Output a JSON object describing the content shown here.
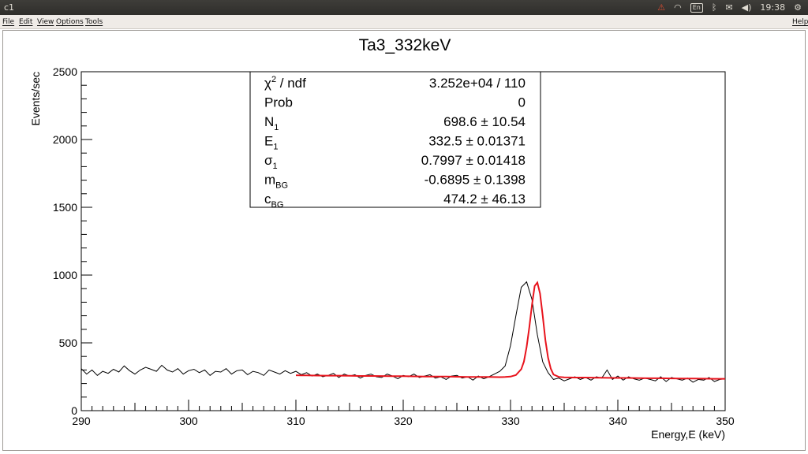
{
  "window": {
    "title": "c1"
  },
  "tray": {
    "network_alert_icon": "network-alert-icon",
    "keyboard_layout": "En",
    "clock": "19:38"
  },
  "menu": {
    "file": "File",
    "edit": "Edit",
    "view": "View",
    "options": "Options",
    "tools": "Tools",
    "help": "Help"
  },
  "colors": {
    "data": "#000000",
    "fit": "#e8141d",
    "frame": "#000000"
  },
  "stats": {
    "rows": [
      {
        "name": "χ",
        "sup": "2",
        "sub": "",
        "suffix": " / ndf",
        "value": "3.252e+04 / 110"
      },
      {
        "name": "Prob",
        "sup": "",
        "sub": "",
        "suffix": "",
        "value": "0"
      },
      {
        "name": "N",
        "sup": "",
        "sub": "1",
        "suffix": "",
        "value": "698.6 ± 10.54"
      },
      {
        "name": "E",
        "sup": "",
        "sub": "1",
        "suffix": "",
        "value": "332.5 ± 0.01371"
      },
      {
        "name": "σ",
        "sup": "",
        "sub": "1",
        "suffix": "",
        "value": "0.7997 ± 0.01418"
      },
      {
        "name": "m",
        "sup": "",
        "sub": "BG",
        "suffix": "",
        "value": "-0.6895 ± 0.1398"
      },
      {
        "name": "c",
        "sup": "",
        "sub": "BG",
        "suffix": "",
        "value": "474.2 ± 46.13"
      }
    ]
  },
  "chart_data": {
    "type": "line",
    "title": "Ta3_332keV",
    "xlabel": "Energy,E (keV)",
    "ylabel": "Events/sec",
    "xlim": [
      290,
      350
    ],
    "ylim": [
      0,
      2500
    ],
    "xticks": [
      290,
      300,
      310,
      320,
      330,
      340,
      350
    ],
    "yticks": [
      0,
      500,
      1000,
      1500,
      2000,
      2500
    ],
    "grid": false,
    "legend": "none",
    "series": [
      {
        "kind": "histogram",
        "x": [
          290.0,
          290.5,
          291.0,
          291.5,
          292.0,
          292.5,
          293.0,
          293.5,
          294.0,
          294.5,
          295.0,
          295.5,
          296.0,
          296.5,
          297.0,
          297.5,
          298.0,
          298.5,
          299.0,
          299.5,
          300.0,
          300.5,
          301.0,
          301.5,
          302.0,
          302.5,
          303.0,
          303.5,
          304.0,
          304.5,
          305.0,
          305.5,
          306.0,
          306.5,
          307.0,
          307.5,
          308.0,
          308.5,
          309.0,
          309.5,
          310.0,
          310.5,
          311.0,
          311.5,
          312.0,
          312.5,
          313.0,
          313.5,
          314.0,
          314.5,
          315.0,
          315.5,
          316.0,
          316.5,
          317.0,
          317.5,
          318.0,
          318.5,
          319.0,
          319.5,
          320.0,
          320.5,
          321.0,
          321.5,
          322.0,
          322.5,
          323.0,
          323.5,
          324.0,
          324.5,
          325.0,
          325.5,
          326.0,
          326.5,
          327.0,
          327.5,
          328.0,
          328.5,
          329.0,
          329.5,
          330.0,
          330.5,
          331.0,
          331.5,
          332.0,
          332.5,
          333.0,
          333.5,
          334.0,
          334.5,
          335.0,
          335.5,
          336.0,
          336.5,
          337.0,
          337.5,
          338.0,
          338.5,
          339.0,
          339.5,
          340.0,
          340.5,
          341.0,
          341.5,
          342.0,
          342.5,
          343.0,
          343.5,
          344.0,
          344.5,
          345.0,
          345.5,
          346.0,
          346.5,
          347.0,
          347.5,
          348.0,
          348.5,
          349.0,
          349.5,
          350.0
        ],
        "y": [
          310,
          270,
          300,
          260,
          290,
          275,
          305,
          285,
          330,
          295,
          270,
          300,
          320,
          305,
          290,
          335,
          300,
          285,
          310,
          270,
          295,
          305,
          280,
          300,
          260,
          290,
          285,
          310,
          270,
          295,
          300,
          265,
          290,
          280,
          260,
          300,
          285,
          270,
          295,
          275,
          290,
          265,
          280,
          255,
          270,
          250,
          260,
          275,
          245,
          270,
          255,
          265,
          240,
          260,
          270,
          250,
          245,
          270,
          255,
          235,
          260,
          250,
          270,
          245,
          255,
          265,
          240,
          250,
          230,
          255,
          260,
          240,
          250,
          225,
          255,
          235,
          250,
          270,
          290,
          330,
          480,
          700,
          910,
          950,
          820,
          560,
          360,
          280,
          230,
          240,
          220,
          235,
          250,
          230,
          245,
          225,
          250,
          240,
          300,
          230,
          255,
          225,
          250,
          235,
          225,
          240,
          230,
          220,
          250,
          215,
          245,
          235,
          225,
          240,
          210,
          230,
          225,
          245,
          215,
          230,
          235
        ]
      },
      {
        "kind": "fit",
        "name": "",
        "x": [
          310.0,
          311.0,
          312.0,
          313.0,
          314.0,
          315.0,
          316.0,
          317.0,
          318.0,
          319.0,
          320.0,
          321.0,
          322.0,
          323.0,
          324.0,
          325.0,
          326.0,
          327.0,
          328.0,
          329.0,
          329.5,
          330.0,
          330.5,
          331.0,
          331.25,
          331.5,
          331.75,
          332.0,
          332.25,
          332.5,
          332.75,
          333.0,
          333.25,
          333.5,
          333.75,
          334.0,
          334.5,
          335.0,
          335.5,
          336.0,
          337.0,
          338.0,
          339.0,
          340.0,
          341.0,
          342.0,
          343.0,
          344.0,
          345.0,
          346.0,
          347.0,
          348.0,
          349.0,
          350.0
        ],
        "y": [
          261,
          260,
          259,
          258,
          258,
          257,
          256,
          256,
          255,
          254,
          254,
          253,
          252,
          251,
          251,
          250,
          249,
          249,
          248,
          247,
          248,
          251,
          262,
          306,
          362,
          470,
          614,
          780,
          919,
          945,
          864,
          700,
          520,
          390,
          310,
          267,
          249,
          246,
          245,
          244,
          244,
          243,
          242,
          241,
          241,
          240,
          239,
          239,
          238,
          237,
          237,
          236,
          235,
          235
        ]
      }
    ]
  }
}
